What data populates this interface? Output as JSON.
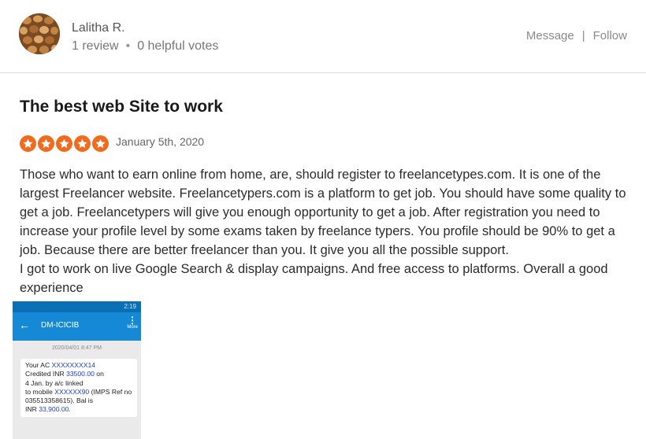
{
  "reviewer": {
    "name": "Lalitha R.",
    "reviews": "1 review",
    "helpful_votes": "0 helpful votes",
    "separator": "•"
  },
  "actions": {
    "message": "Message",
    "divider": "|",
    "follow": "Follow"
  },
  "review": {
    "title": "The best web Site to work",
    "rating": 5,
    "star_color": "#f26b1d",
    "date": "January 5th, 2020",
    "paragraph1": "Those who want to earn online from home, are, should register to freelancetypes.com. It is one of the largest Freelancer website. Freelancetypers.com is a platform to get job. You should have some quality to get a job. Freelancetypers will give you enough opportunity to get a job. After registration you need to increase your profile level by some exams taken by freelance typers. You profile should be 90% to get a job. Because there are better freelancer than you. It give you all the possible support.",
    "paragraph2": "I got to work on live Google Search & display campaigns. And free access to platforms. Overall a good experience"
  },
  "attachment": {
    "status_time": "2:19",
    "app_title": "DM-ICICIB",
    "more_label": "More",
    "timestamp": "2020/04/01 8:47 PM",
    "sms": {
      "l1_prefix": "Your AC ",
      "account": "XXXXXXXX14",
      "l2_prefix": "Credited INR ",
      "amount": "33500.00",
      "l2_suffix": " on",
      "l3": "4 Jan. by a/c linked",
      "l4_prefix": "to mobile ",
      "mobile": "XXXXXX90",
      "l4_suffix": " (IMPS Ref no",
      "l5": "035513358615). Bal is",
      "l6_prefix": "INR ",
      "balance": "33,900.00",
      "l6_suffix": "."
    }
  }
}
